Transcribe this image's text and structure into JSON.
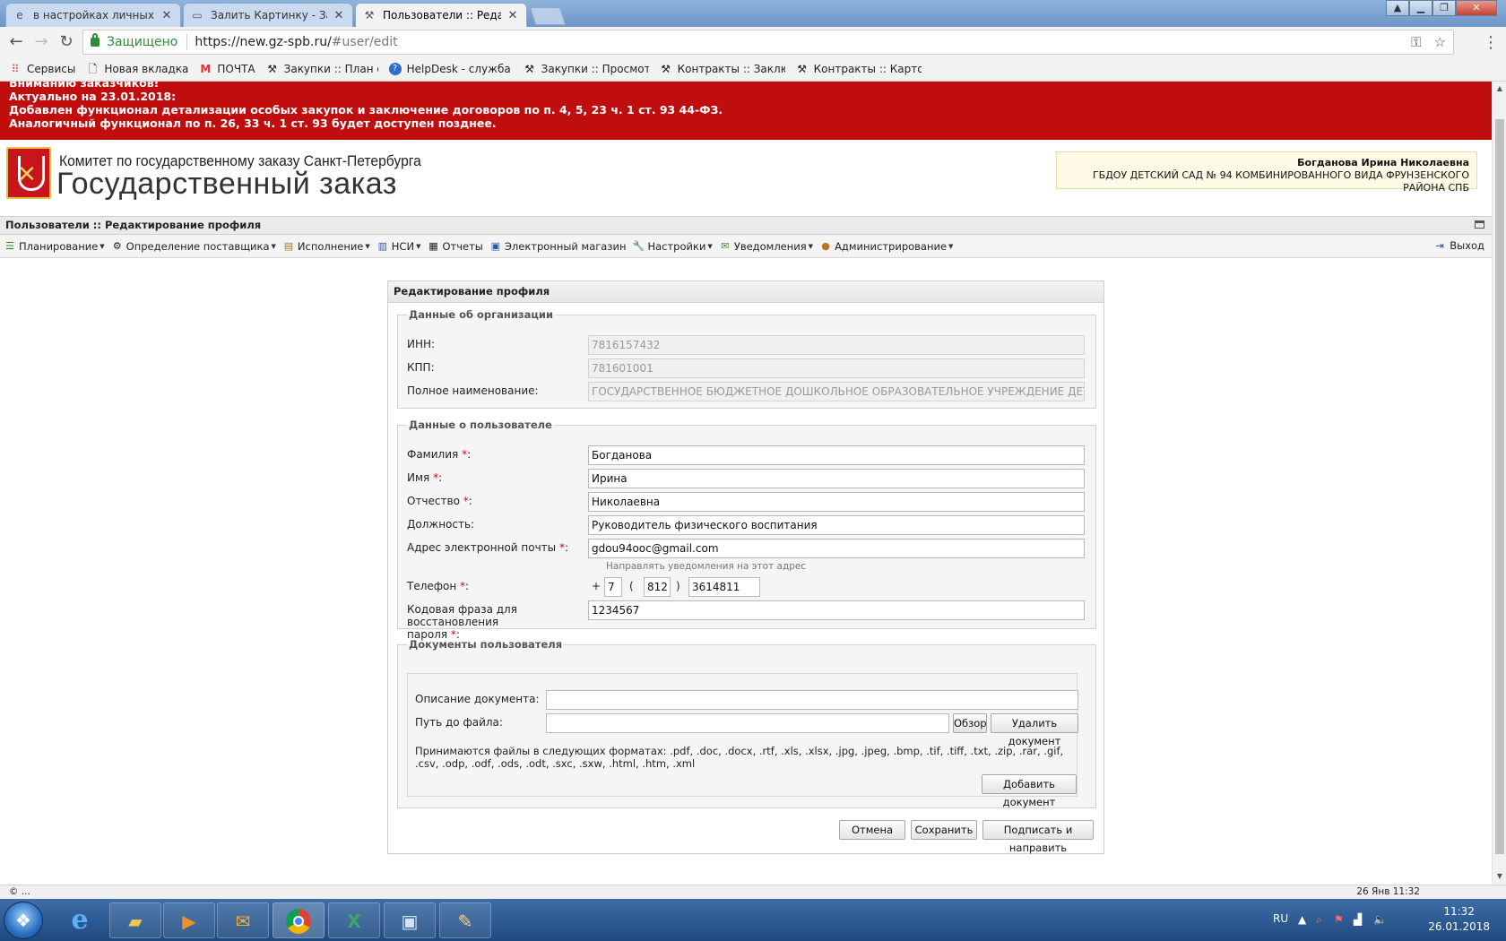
{
  "browser": {
    "tabs": [
      {
        "title": "в настройках личных св",
        "icon": "ie-icon"
      },
      {
        "title": "Залить Картинку - Загру",
        "icon": "image-icon"
      },
      {
        "title": "Пользователи :: Редакти",
        "icon": "hammer-icon"
      }
    ],
    "secure_label": "Защищено",
    "url_host": "https://new.gz-spb.ru/",
    "url_path": "#user/edit",
    "bookmarks": [
      {
        "label": "Сервисы",
        "icon": "apps-grid-icon"
      },
      {
        "label": "Новая вкладка",
        "icon": "page-icon"
      },
      {
        "label": "ПОЧТА",
        "icon": "gmail-icon"
      },
      {
        "label": "Закупки :: План осуш",
        "icon": "hammer-icon"
      },
      {
        "label": "HelpDesk - служба те",
        "icon": "help-icon"
      },
      {
        "label": "Закупки :: Просмотр",
        "icon": "hammer-icon"
      },
      {
        "label": "Контракты :: Заключ",
        "icon": "hammer-icon"
      },
      {
        "label": "Контракты :: Карточ",
        "icon": "hammer-icon"
      }
    ]
  },
  "alert": {
    "line0": "Вниманию заказчиков!",
    "line1": "Актуально на 23.01.2018:",
    "line2": "Добавлен функционал детализации особых закупок и заключение договоров по п. 4, 5, 23 ч. 1 ст. 93 44-ФЗ.",
    "line3": "Аналогичный функционал по п. 26, 33 ч. 1 ст. 93 будет доступен позднее."
  },
  "header": {
    "org_name": "Комитет по государственному заказу Санкт-Петербурга",
    "site_title": "Государственный заказ",
    "user_name": "Богданова Ирина Николаевна",
    "user_org": "ГБДОУ ДЕТСКИЙ САД № 94 КОМБИНИРОВАННОГО ВИДА ФРУНЗЕНСКОГО РАЙОНА СПБ"
  },
  "breadcrumb": "Пользователи :: Редактирование профиля",
  "menu": [
    {
      "label": "Планирование",
      "icon": "planning-icon",
      "dropdown": true
    },
    {
      "label": "Определение поставщика",
      "icon": "gears-icon",
      "dropdown": true
    },
    {
      "label": "Исполнение",
      "icon": "execution-icon",
      "dropdown": true
    },
    {
      "label": "НСИ",
      "icon": "book-icon",
      "dropdown": true
    },
    {
      "label": "Отчеты",
      "icon": "report-icon",
      "dropdown": false
    },
    {
      "label": "Электронный магазин",
      "icon": "cart-icon",
      "dropdown": false
    },
    {
      "label": "Настройки",
      "icon": "wrench-icon",
      "dropdown": true
    },
    {
      "label": "Уведомления",
      "icon": "notification-icon",
      "dropdown": true
    },
    {
      "label": "Администрирование",
      "icon": "user-admin-icon",
      "dropdown": true
    }
  ],
  "exit_label": "Выход",
  "form": {
    "title": "Редактирование профиля",
    "org_section": "Данные об организации",
    "inn_label": "ИНН:",
    "inn_value": "7816157432",
    "kpp_label": "КПП:",
    "kpp_value": "781601001",
    "fullname_label": "Полное наименование:",
    "fullname_value": "ГОСУДАРСТВЕННОЕ БЮДЖЕТНОЕ ДОШКОЛЬНОЕ ОБРАЗОВАТЕЛЬНОЕ УЧРЕЖДЕНИЕ ДЕТСКИЙ САД",
    "user_section": "Данные о пользователе",
    "lastname_label": "Фамилия",
    "lastname_value": "Богданова",
    "firstname_label": "Имя",
    "firstname_value": "Ирина",
    "middlename_label": "Отчество",
    "middlename_value": "Николаевна",
    "position_label": "Должность:",
    "position_value": "Руководитель физического воспитания",
    "email_label": "Адрес электронной почты",
    "email_value": "gdou94ooc@gmail.com",
    "email_hint": "Направлять уведомления на этот адрес",
    "phone_label": "Телефон",
    "phone_plus": "+",
    "phone_country": "7",
    "phone_open": "(",
    "phone_code": "812",
    "phone_close": ")",
    "phone_number": "3614811",
    "codephrase_label_1": "Кодовая фраза для восстановления",
    "codephrase_label_2": "пароля",
    "codephrase_value": "1234567",
    "req_mark": "*",
    "colon": ":",
    "docs_section": "Документы пользователя",
    "doc_desc_label": "Описание документа:",
    "doc_desc_value": "",
    "doc_path_label": "Путь до файла:",
    "doc_path_value": "",
    "browse_label": "Обзор",
    "delete_doc_label": "Удалить документ",
    "formats_text": "Принимаются файлы в следующих форматах: .pdf, .doc, .docx, .rtf, .xls, .xlsx, .jpg, .jpeg, .bmp, .tif, .tiff, .txt, .zip, .rar, .gif, .csv, .odp, .odf, .ods, .odt, .sxc, .sxw, .html, .htm, .xml",
    "add_doc_label": "Добавить документ",
    "cancel_label": "Отмена",
    "save_label": "Сохранить",
    "sign_send_label": "Подписать и направить"
  },
  "statusbar": {
    "left": "© ...",
    "right": "26 Янв 11:32"
  },
  "taskbar": {
    "lang": "RU",
    "time": "11:32",
    "date": "26.01.2018"
  }
}
